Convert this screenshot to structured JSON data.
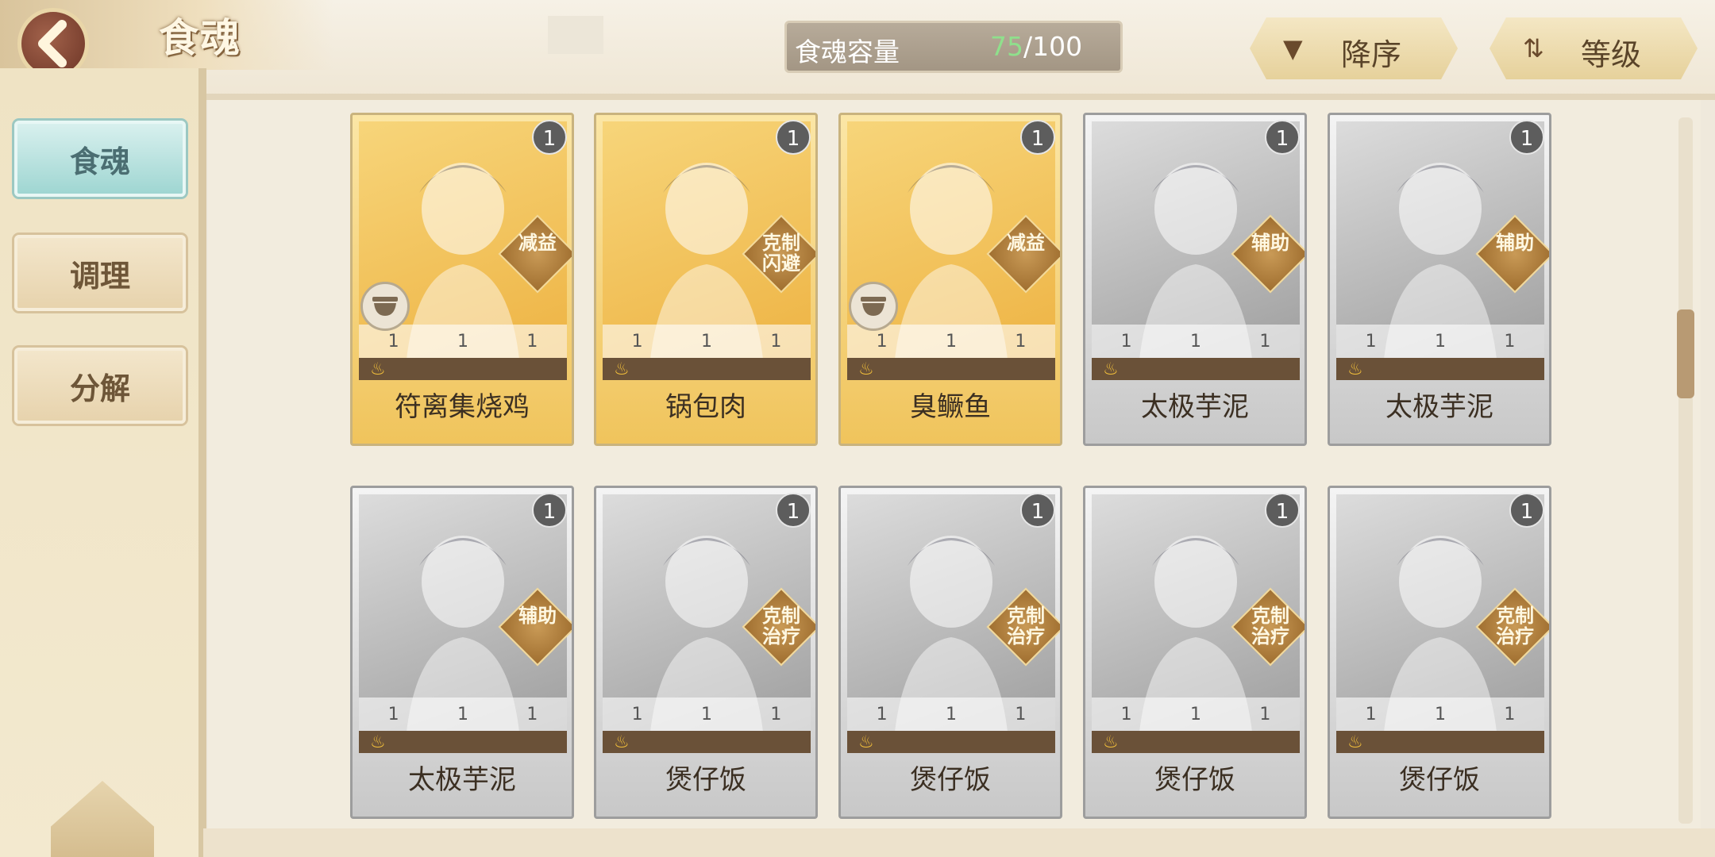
{
  "header": {
    "title": "食魂",
    "capacity_label": "食魂容量",
    "capacity_current": "75",
    "capacity_max": "/100",
    "sort_order_label": "降序",
    "sort_by_label": "等级"
  },
  "sidebar": {
    "tabs": [
      {
        "label": "食魂",
        "active": true
      },
      {
        "label": "调理",
        "active": false
      },
      {
        "label": "分解",
        "active": false
      }
    ]
  },
  "cards": [
    {
      "name": "符离集烧鸡",
      "level": "1",
      "tag": "减益",
      "rarity": "gold",
      "badge": true,
      "stats": [
        "1",
        "1",
        "1"
      ]
    },
    {
      "name": "锅包肉",
      "level": "1",
      "tag": "克制\n闪避",
      "rarity": "gold",
      "badge": false,
      "stats": [
        "1",
        "1",
        "1"
      ]
    },
    {
      "name": "臭鳜鱼",
      "level": "1",
      "tag": "减益",
      "rarity": "gold",
      "badge": true,
      "stats": [
        "1",
        "1",
        "1"
      ]
    },
    {
      "name": "太极芋泥",
      "level": "1",
      "tag": "辅助",
      "rarity": "gray",
      "badge": false,
      "stats": [
        "1",
        "1",
        "1"
      ]
    },
    {
      "name": "太极芋泥",
      "level": "1",
      "tag": "辅助",
      "rarity": "gray",
      "badge": false,
      "stats": [
        "1",
        "1",
        "1"
      ]
    },
    {
      "name": "太极芋泥",
      "level": "1",
      "tag": "辅助",
      "rarity": "gray",
      "badge": false,
      "stats": [
        "1",
        "1",
        "1"
      ]
    },
    {
      "name": "煲仔饭",
      "level": "1",
      "tag": "克制\n治疗",
      "rarity": "gray",
      "badge": false,
      "stats": [
        "1",
        "1",
        "1"
      ]
    },
    {
      "name": "煲仔饭",
      "level": "1",
      "tag": "克制\n治疗",
      "rarity": "gray",
      "badge": false,
      "stats": [
        "1",
        "1",
        "1"
      ]
    },
    {
      "name": "煲仔饭",
      "level": "1",
      "tag": "克制\n治疗",
      "rarity": "gray",
      "badge": false,
      "stats": [
        "1",
        "1",
        "1"
      ]
    },
    {
      "name": "煲仔饭",
      "level": "1",
      "tag": "克制\n治疗",
      "rarity": "gray",
      "badge": false,
      "stats": [
        "1",
        "1",
        "1"
      ]
    }
  ],
  "colors": {
    "capacity_current": "#8fe08c",
    "active_tab": "#9fd6d2",
    "gold_card": "#f0c45c"
  }
}
